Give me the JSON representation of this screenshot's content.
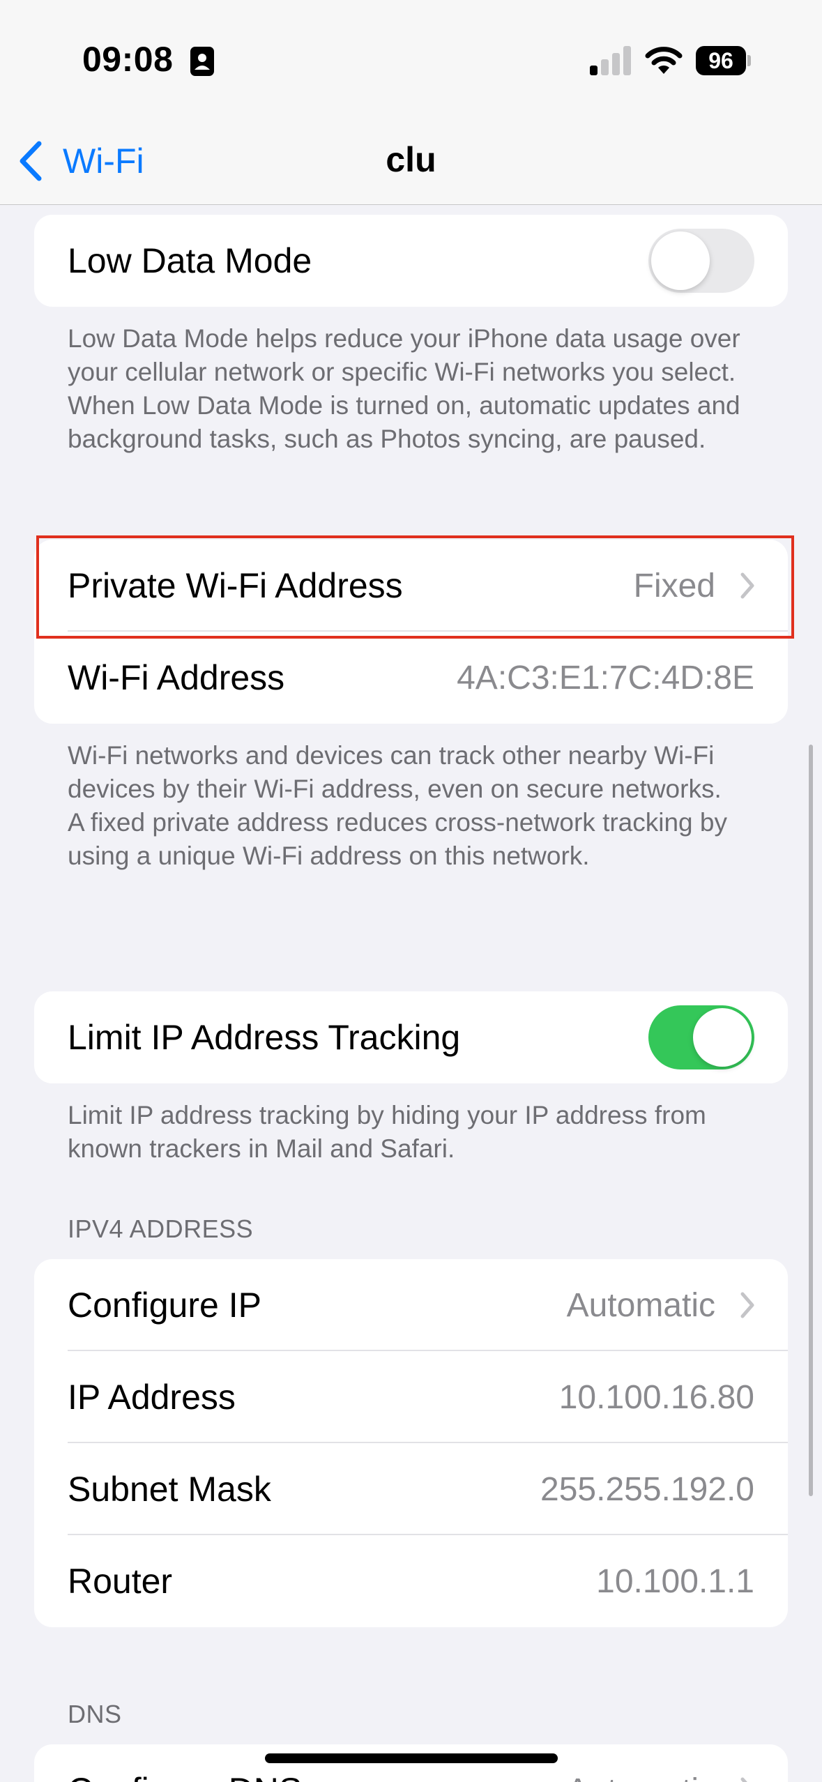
{
  "status_bar": {
    "time": "09:08",
    "battery": "96",
    "icons": [
      "contact-card-icon",
      "cellular-signal-icon",
      "wifi-icon",
      "battery-icon"
    ]
  },
  "nav": {
    "back_label": "Wi-Fi",
    "title": "clu"
  },
  "low_data_mode": {
    "label": "Low Data Mode",
    "enabled": false,
    "footer": "Low Data Mode helps reduce your iPhone data usage over your cellular network or specific Wi-Fi networks you select. When Low Data Mode is turned on, automatic updates and background tasks, such as Photos syncing, are paused."
  },
  "private_address": {
    "private_label": "Private Wi-Fi Address",
    "private_value": "Fixed",
    "wifi_address_label": "Wi-Fi Address",
    "wifi_address_value": "4A:C3:E1:7C:4D:8E",
    "footer_1": "Wi-Fi networks and devices can track other nearby Wi-Fi devices by their Wi-Fi address, even on secure networks.",
    "footer_2": "A fixed private address reduces cross-network tracking by using a unique Wi-Fi address on this network."
  },
  "limit_ip": {
    "label": "Limit IP Address Tracking",
    "enabled": true,
    "footer": "Limit IP address tracking by hiding your IP address from known trackers in Mail and Safari."
  },
  "ipv4": {
    "header": "IPV4 ADDRESS",
    "rows": [
      {
        "label": "Configure IP",
        "value": "Automatic"
      },
      {
        "label": "IP Address",
        "value": "10.100.16.80"
      },
      {
        "label": "Subnet Mask",
        "value": "255.255.192.0"
      },
      {
        "label": "Router",
        "value": "10.100.1.1"
      }
    ]
  },
  "dns": {
    "header": "DNS",
    "configure_label": "Configure DNS",
    "configure_value": "Automatic"
  },
  "colors": {
    "accent": "#0a7aff",
    "toggle_on": "#34c759",
    "highlight": "#e0301e"
  }
}
